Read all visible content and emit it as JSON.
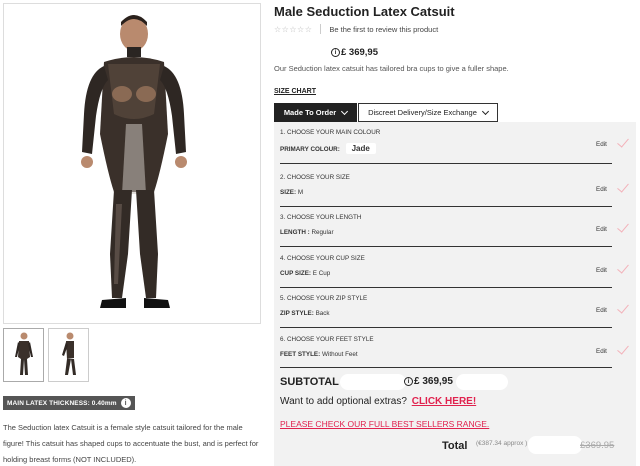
{
  "product": {
    "title": "Male Seduction Latex Catsuit",
    "review_link": "Be the first to review this product",
    "stars_empty": "☆☆☆☆☆",
    "price": "£ 369,95",
    "info_symbol": "i",
    "subheading": "Our Seduction latex catsuit has tailored bra cups to give a fuller shape.",
    "size_chart": "SIZE CHART"
  },
  "tabs": [
    {
      "label": "Made To Order"
    },
    {
      "label": "Discreet Delivery/Size Exchange"
    }
  ],
  "options": [
    {
      "heading": "1. CHOOSE YOUR MAIN COLOUR",
      "label": "PRIMARY COLOUR:",
      "value": "Jade",
      "edit": "Edit"
    },
    {
      "heading": "2. CHOOSE YOUR SIZE",
      "label": "SIZE:",
      "value": "M",
      "edit": "Edit"
    },
    {
      "heading": "3. CHOOSE YOUR LENGTH",
      "label": "LENGTH :",
      "value": "Regular",
      "edit": "Edit"
    },
    {
      "heading": "4. CHOOSE YOUR CUP SIZE",
      "label": "CUP SIZE:",
      "value": "E Cup",
      "edit": "Edit"
    },
    {
      "heading": "5. CHOOSE YOUR ZIP STYLE",
      "label": "ZIP STYLE:",
      "value": "Back",
      "edit": "Edit"
    },
    {
      "heading": "6. CHOOSE YOUR FEET STYLE",
      "label": "FEET STYLE:",
      "value": "Without Feet",
      "edit": "Edit"
    }
  ],
  "summary": {
    "subtotal_label": "SUBTOTAL",
    "subtotal_price": "£ 369,95",
    "extras_question": "Want to add optional extras?",
    "extras_link": "CLICK HERE!",
    "bestsellers_link": "PLEASE CHECK OUR FULL BEST SELLERS RANGE.",
    "total_label": "Total",
    "total_approx": "(€387.34 approx )",
    "total_old": "£369.95"
  },
  "left": {
    "thickness_badge": "MAIN LATEX THICKNESS: 0.40mm",
    "description": "The Seduction latex Catsuit is a female style catsuit tailored for the male figure! This catsuit has shaped cups to accentuate the bust, and is perfect for holding breast forms (NOT INCLUDED)."
  },
  "colors": {
    "accent_pink": "#e0224e",
    "tick_pink": "#f3b1b9",
    "dark": "#222222",
    "panel_bg": "#f2f2f2"
  }
}
